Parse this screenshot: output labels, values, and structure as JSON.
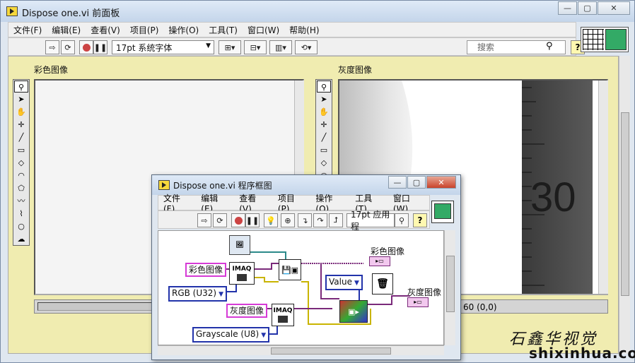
{
  "front_panel": {
    "title": "Dispose one.vi 前面板",
    "menu": [
      "文件(F)",
      "编辑(E)",
      "查看(V)",
      "项目(P)",
      "操作(O)",
      "工具(T)",
      "窗口(W)",
      "帮助(H)"
    ],
    "font_select": "17pt 系统字体",
    "search_placeholder": "搜索",
    "help_label": "?",
    "color_image_label": "彩色图像",
    "gray_image_label": "灰度图像",
    "status_values": "60    (0,0)",
    "gray_image_digit": "30"
  },
  "block_diagram": {
    "title": "Dispose one.vi 程序框图",
    "menu": [
      "文件(F)",
      "编辑(E)",
      "查看(V)",
      "项目(P)",
      "操作(O)",
      "工具(T)",
      "窗口(W)"
    ],
    "font_select": "17pt 应用程",
    "help_label": "?",
    "color_const": "彩色图像",
    "gray_const": "灰度图像",
    "rgb_enum": "RGB (U32)",
    "gray_enum": "Grayscale (U8)",
    "value_enum": "Value",
    "color_indicator_label": "彩色图像",
    "gray_indicator_label": "灰度图像",
    "imaq_label": "IMAQ"
  },
  "watermark": {
    "chinese": "石鑫华视觉",
    "url": "shixinhua.com"
  },
  "icons": [
    "run-arrow-icon",
    "run-continuous-icon",
    "abort-icon",
    "pause-icon",
    "search-icon",
    "help-icon",
    "vi-icon"
  ]
}
